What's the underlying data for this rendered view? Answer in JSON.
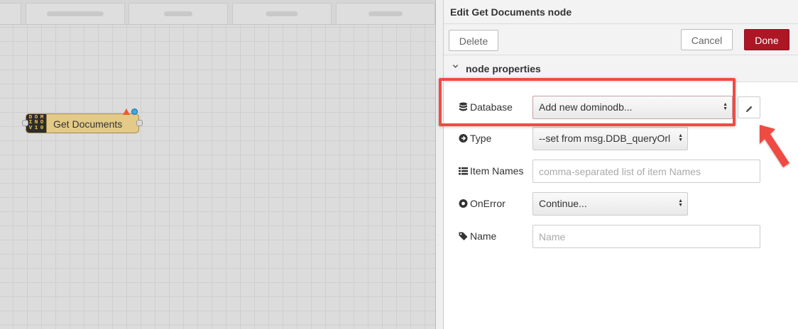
{
  "canvas": {
    "workspace_tabs": [
      {
        "width_hint": "wide"
      },
      {
        "width_hint": "wide"
      },
      {
        "width_hint": "wide"
      },
      {
        "width_hint": "wide"
      }
    ],
    "node": {
      "label": "Get Documents",
      "icon_letters": [
        "D",
        "O",
        "M",
        "I",
        "N",
        "O",
        "V",
        "1",
        "0"
      ],
      "color": "#e4ca88"
    }
  },
  "tray": {
    "title": "Edit Get Documents node",
    "buttons": {
      "delete": "Delete",
      "cancel": "Cancel",
      "done": "Done"
    },
    "section": {
      "title": "node properties",
      "chevron_icon": "chevron-down-icon"
    },
    "fields": {
      "database": {
        "label": "Database",
        "icon": "database-icon",
        "value": "Add new dominodb...",
        "edit_icon": "pencil-icon"
      },
      "type": {
        "label": "Type",
        "icon": "arrow-circle-right-icon",
        "value": "--set from msg.DDB_queryOrl"
      },
      "item_names": {
        "label": "Item Names",
        "icon": "list-icon",
        "value": "",
        "placeholder": "comma-separated list of item Names"
      },
      "on_error": {
        "label": "OnError",
        "icon": "circle-dot-icon",
        "value": "Continue..."
      },
      "name": {
        "label": "Name",
        "icon": "tag-icon",
        "value": "",
        "placeholder": "Name"
      }
    }
  },
  "colors": {
    "done_button": "#ad1625",
    "highlight": "#ef4b43",
    "status_dot": "#3ea9e0",
    "changed_badge": "#ee5a2c"
  }
}
